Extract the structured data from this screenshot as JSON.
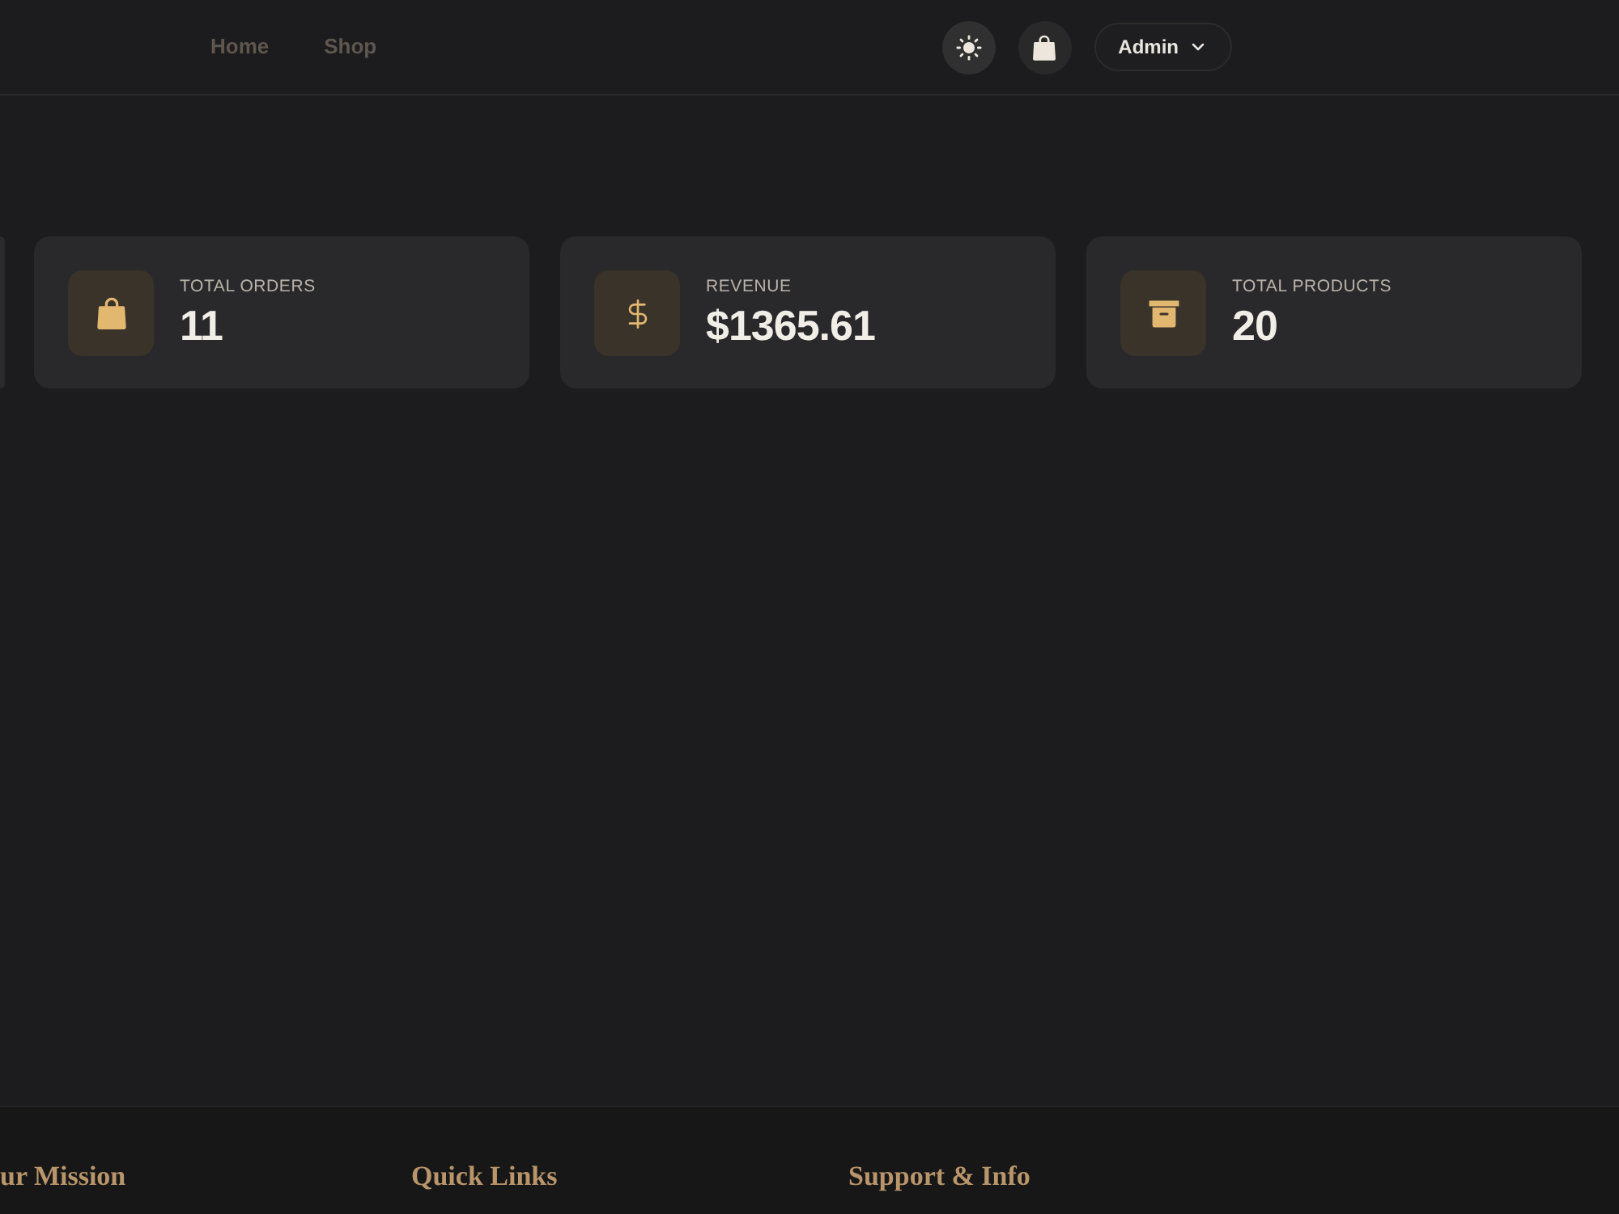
{
  "header": {
    "nav_links": [
      {
        "label": "Home"
      },
      {
        "label": "Shop"
      }
    ],
    "user_menu": {
      "label": "Admin"
    }
  },
  "stats": [
    {
      "kind": "clipped"
    },
    {
      "kind": "stat",
      "label": "TOTAL ORDERS",
      "value": "11"
    },
    {
      "kind": "stat",
      "label": "REVENUE",
      "value": "$1365.61"
    },
    {
      "kind": "stat",
      "label": "TOTAL PRODUCTS",
      "value": "20"
    }
  ],
  "footer": {
    "headings": [
      "ur Mission",
      "Quick Links",
      "Support & Info"
    ]
  }
}
